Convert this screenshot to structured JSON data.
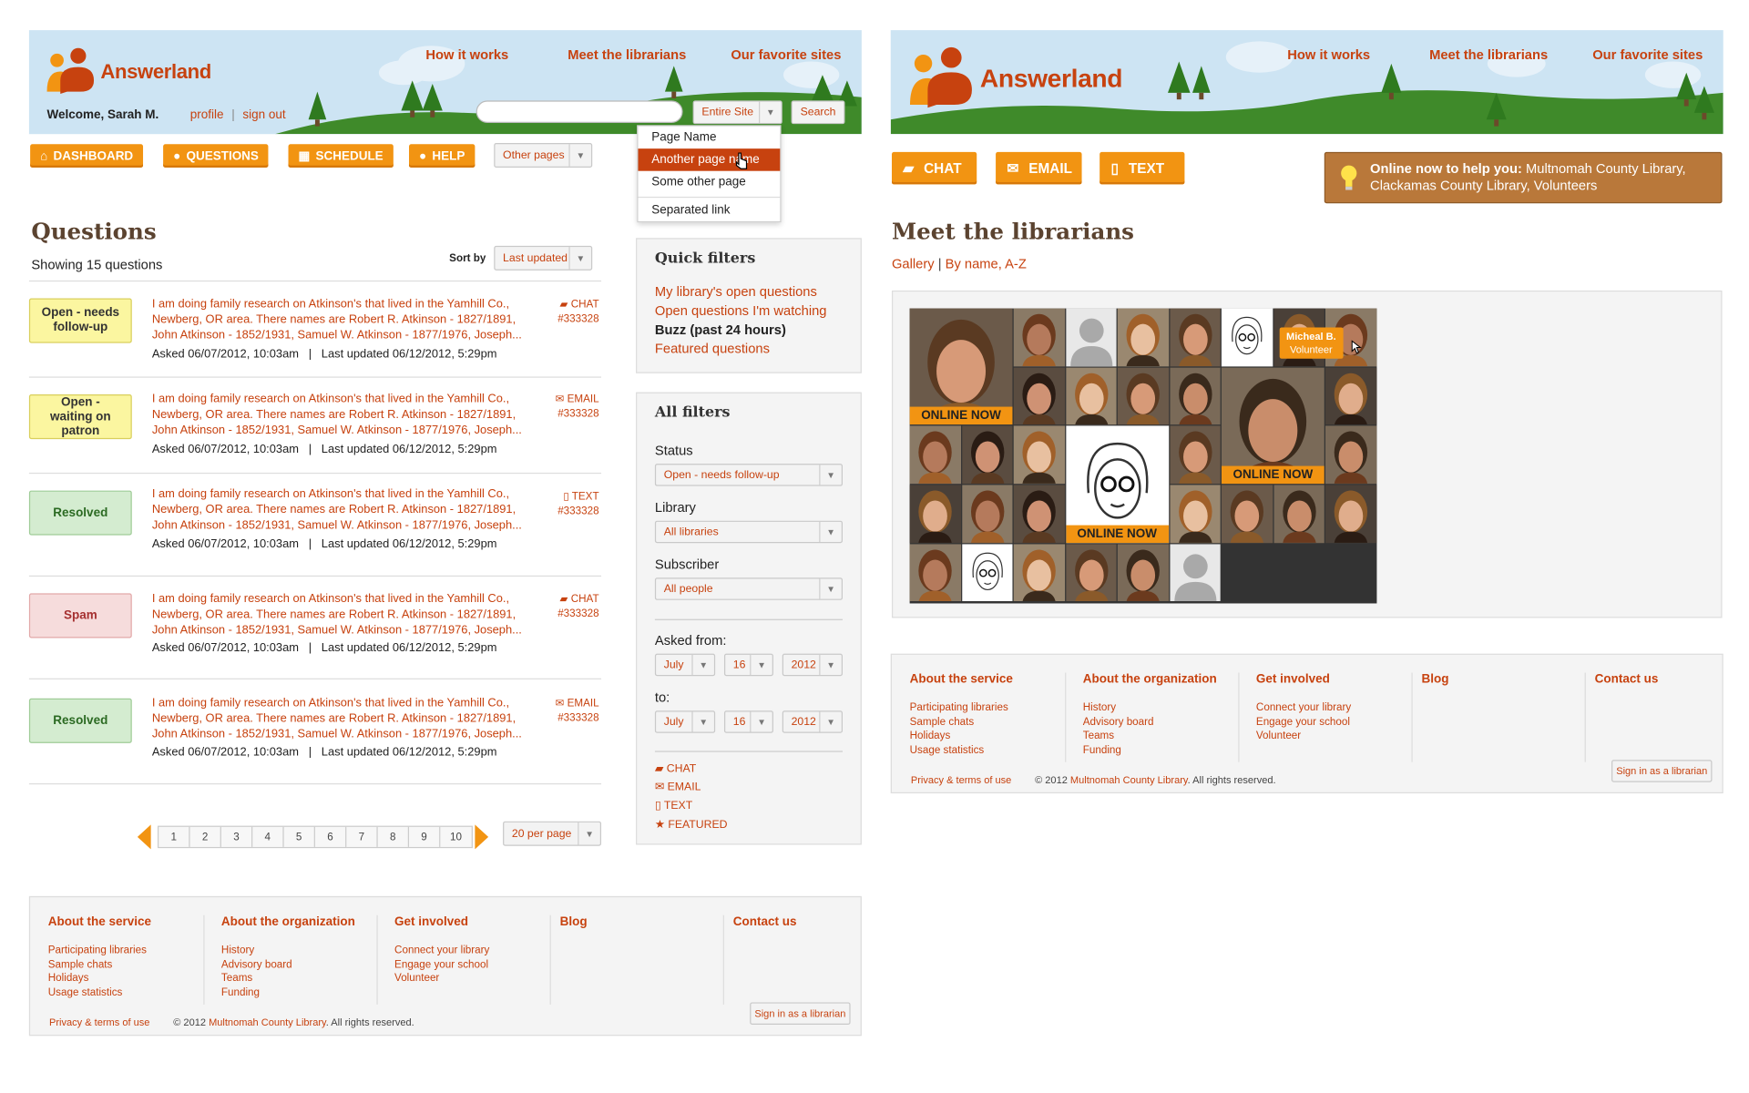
{
  "brand": {
    "name": "Answerland"
  },
  "left": {
    "nav": [
      "How it works",
      "Meet the librarians",
      "Our favorite sites"
    ],
    "welcome": "Welcome, Sarah M.",
    "profile": "profile",
    "sep": "|",
    "signout": "sign out",
    "search": {
      "value": "",
      "scope": "Entire Site",
      "button": "Search"
    },
    "scope_menu": [
      "Page Name",
      "Another page name",
      "Some other page",
      "Separated link"
    ],
    "tabs": [
      "DASHBOARD",
      "QUESTIONS",
      "SCHEDULE",
      "HELP"
    ],
    "other_pages": "Other pages",
    "title": "Questions",
    "showing": "Showing 15 questions",
    "sort_by": "Sort by",
    "sort_value": "Last updated",
    "questions": [
      {
        "status": "Open - needs follow-up",
        "type": "CHAT",
        "id": "#333328",
        "line1": "I am doing family research on Atkinson's that lived in the Yamhill Co.,",
        "line2": "Newberg, OR area. There names are Robert R. Atkinson - 1827/1891,",
        "line3": "John Atkinson - 1852/1931, Samuel W. Atkinson - 1877/1976, Joseph...",
        "meta": "Asked 06/07/2012, 10:03am   |   Last updated 06/12/2012, 5:29pm"
      },
      {
        "status": "Open - waiting on patron",
        "type": "EMAIL",
        "id": "#333328",
        "line1": "I am doing family research on Atkinson's that lived in the Yamhill Co.,",
        "line2": "Newberg, OR area. There names are Robert R. Atkinson - 1827/1891,",
        "line3": "John Atkinson - 1852/1931, Samuel W. Atkinson - 1877/1976, Joseph...",
        "meta": "Asked 06/07/2012, 10:03am   |   Last updated 06/12/2012, 5:29pm"
      },
      {
        "status": "Resolved",
        "type": "TEXT",
        "id": "#333328",
        "line1": "I am doing family research on Atkinson's that lived in the Yamhill Co.,",
        "line2": "Newberg, OR area. There names are Robert R. Atkinson - 1827/1891,",
        "line3": "John Atkinson - 1852/1931, Samuel W. Atkinson - 1877/1976, Joseph...",
        "meta": "Asked 06/07/2012, 10:03am   |   Last updated 06/12/2012, 5:29pm"
      },
      {
        "status": "Spam",
        "type": "CHAT",
        "id": "#333328",
        "line1": "I am doing family research on Atkinson's that lived in the Yamhill Co.,",
        "line2": "Newberg, OR area. There names are Robert R. Atkinson - 1827/1891,",
        "line3": "John Atkinson - 1852/1931, Samuel W. Atkinson - 1877/1976, Joseph...",
        "meta": "Asked 06/07/2012, 10:03am   |   Last updated 06/12/2012, 5:29pm"
      },
      {
        "status": "Resolved",
        "type": "EMAIL",
        "id": "#333328",
        "line1": "I am doing family research on Atkinson's that lived in the Yamhill Co.,",
        "line2": "Newberg, OR area. There names are Robert R. Atkinson - 1827/1891,",
        "line3": "John Atkinson - 1852/1931, Samuel W. Atkinson - 1877/1976, Joseph...",
        "meta": "Asked 06/07/2012, 10:03am   |   Last updated 06/12/2012, 5:29pm"
      }
    ],
    "pages": [
      "1",
      "2",
      "3",
      "4",
      "5",
      "6",
      "7",
      "8",
      "9",
      "10"
    ],
    "per_page": "20 per page",
    "quick_filters": {
      "title": "Quick filters",
      "items": [
        "My library's open questions",
        "Open questions I'm watching",
        "Buzz (past 24 hours)",
        "Featured questions"
      ]
    },
    "all_filters": {
      "title": "All filters",
      "status_label": "Status",
      "status_value": "Open - needs follow-up",
      "library_label": "Library",
      "library_value": "All libraries",
      "subscriber_label": "Subscriber",
      "subscriber_value": "All people",
      "from_label": "Asked from:",
      "from": [
        "July",
        "16",
        "2012"
      ],
      "to_label": "to:",
      "to": [
        "July",
        "16",
        "2012"
      ],
      "types": [
        "CHAT",
        "EMAIL",
        "TEXT",
        "FEATURED"
      ]
    }
  },
  "footer": {
    "cols": [
      {
        "head": "About the service",
        "items": [
          "Participating libraries",
          "Sample chats",
          "Holidays",
          "Usage statistics"
        ]
      },
      {
        "head": "About the organization",
        "items": [
          "History",
          "Advisory board",
          "Teams",
          "Funding"
        ]
      },
      {
        "head": "Get involved",
        "items": [
          "Connect your library",
          "Engage your school",
          "Volunteer"
        ]
      },
      {
        "head": "Blog",
        "items": []
      },
      {
        "head": "Contact us",
        "items": []
      }
    ],
    "privacy": "Privacy & terms of use",
    "copy_pre": "© 2012 ",
    "copy_link": "Multnomah County Library",
    "copy_post": ". All rights reserved.",
    "signin": "Sign in as a librarian"
  },
  "right": {
    "nav": [
      "How it works",
      "Meet the librarians",
      "Our favorite sites"
    ],
    "buttons": [
      "CHAT",
      "EMAIL",
      "TEXT"
    ],
    "online_bold": "Online now to help you:",
    "online_text": " Multnomah County Library, Clackamas County Library, Volunteers",
    "title": "Meet the librarians",
    "view_gallery": "Gallery",
    "view_sep": " | ",
    "view_name": "By name, A-Z",
    "online_label": "ONLINE NOW",
    "tooltip_name": "Micheal B.",
    "tooltip_role": "Volunteer"
  },
  "colors": {
    "accent": "#c7420f",
    "orange": "#f29412",
    "sky": "#cde4f3",
    "grass": "#3f8a2a"
  }
}
